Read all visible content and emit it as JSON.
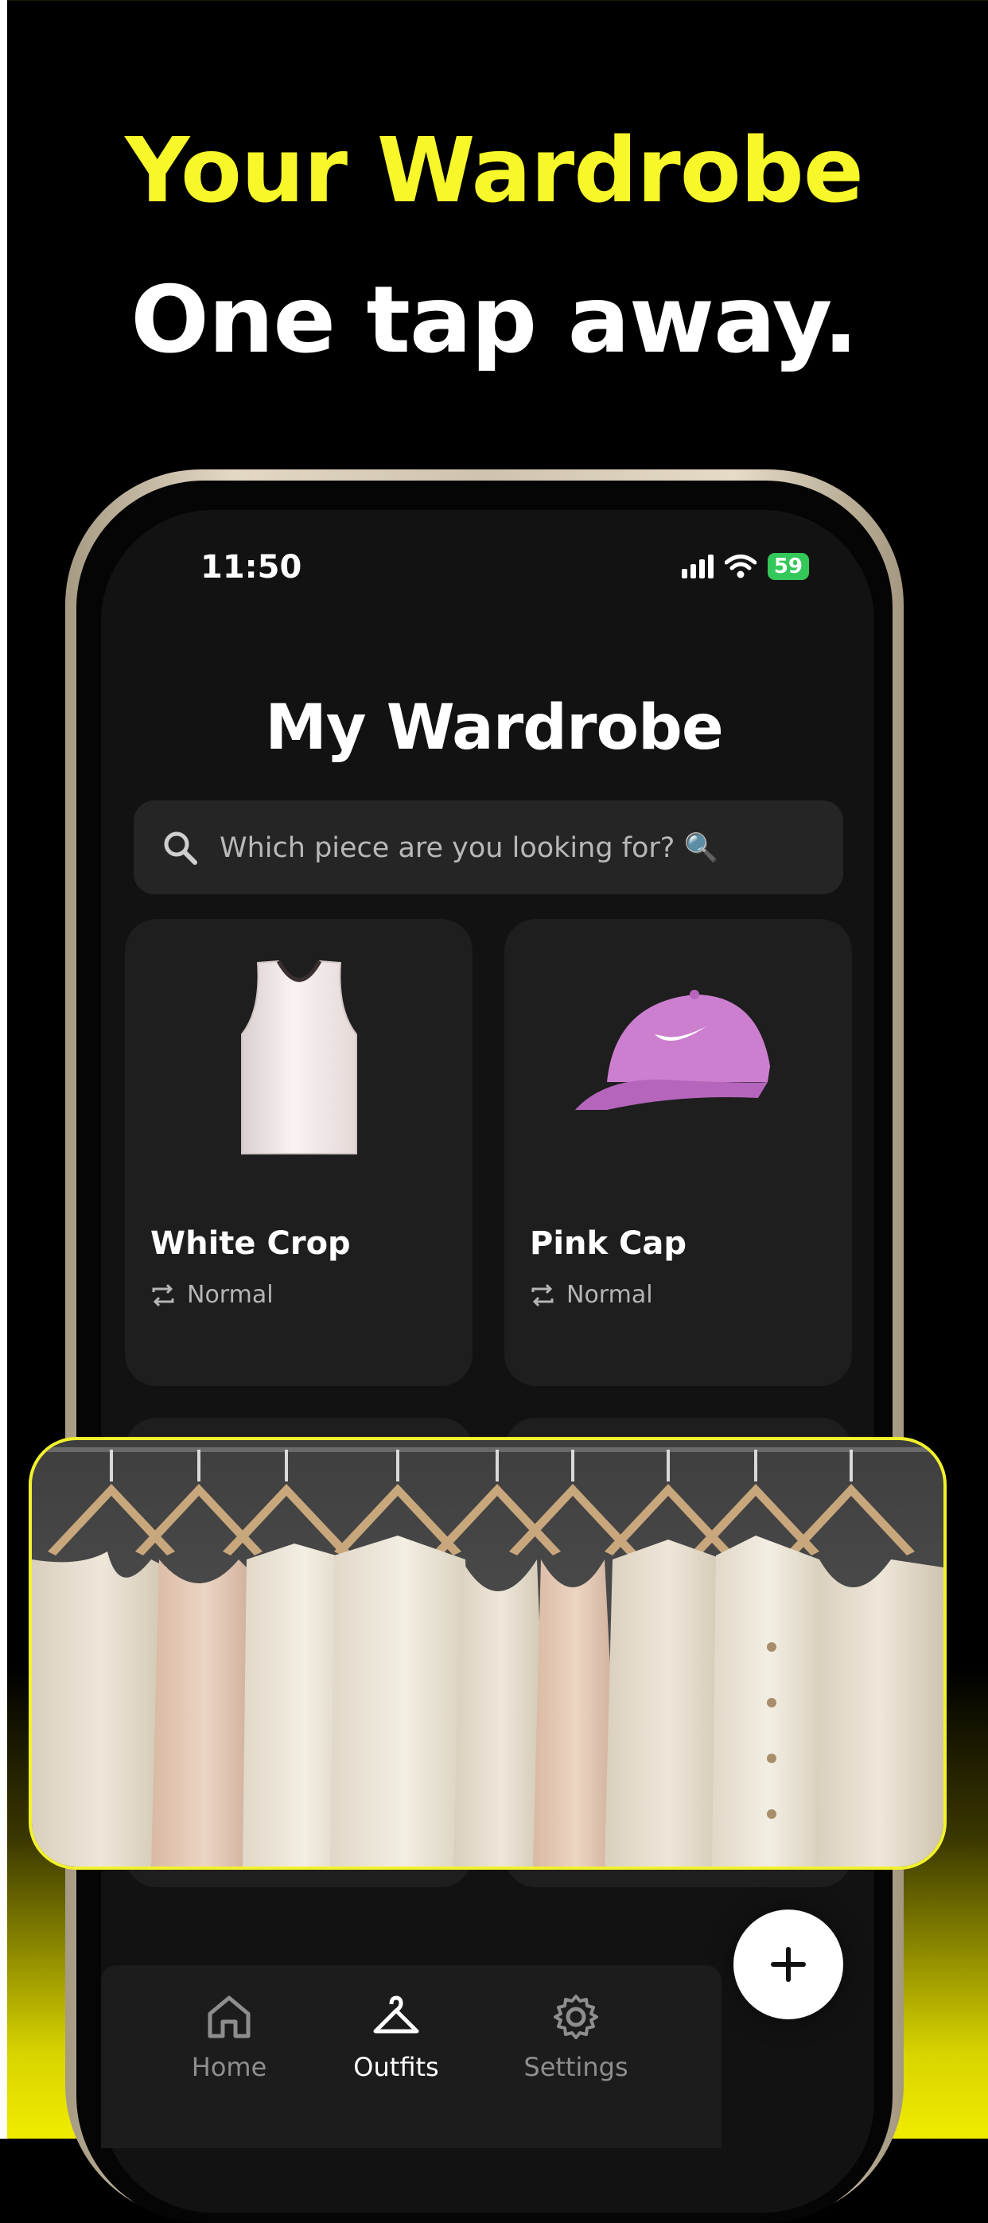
{
  "headline": {
    "line1": "Your Wardrobe",
    "line2": "One tap away."
  },
  "status": {
    "time": "11:50",
    "battery": "59"
  },
  "screen": {
    "title": "My Wardrobe",
    "search": {
      "placeholder": "Which piece are you looking for? 🔍"
    },
    "items": [
      {
        "name": "White Crop",
        "type": "Normal",
        "icon": "tank-top-image"
      },
      {
        "name": "Pink Cap",
        "type": "Normal",
        "icon": "cap-image"
      }
    ]
  },
  "tabbar": {
    "tabs": [
      {
        "label": "Home",
        "icon": "home-icon",
        "active": false
      },
      {
        "label": "Outfits",
        "icon": "hanger-icon",
        "active": true
      },
      {
        "label": "Settings",
        "icon": "gear-icon",
        "active": false
      }
    ]
  },
  "colors": {
    "accent": "#f7f72a",
    "screen_bg": "#121212",
    "card_bg": "#1e1e1e",
    "battery": "#34c759"
  }
}
